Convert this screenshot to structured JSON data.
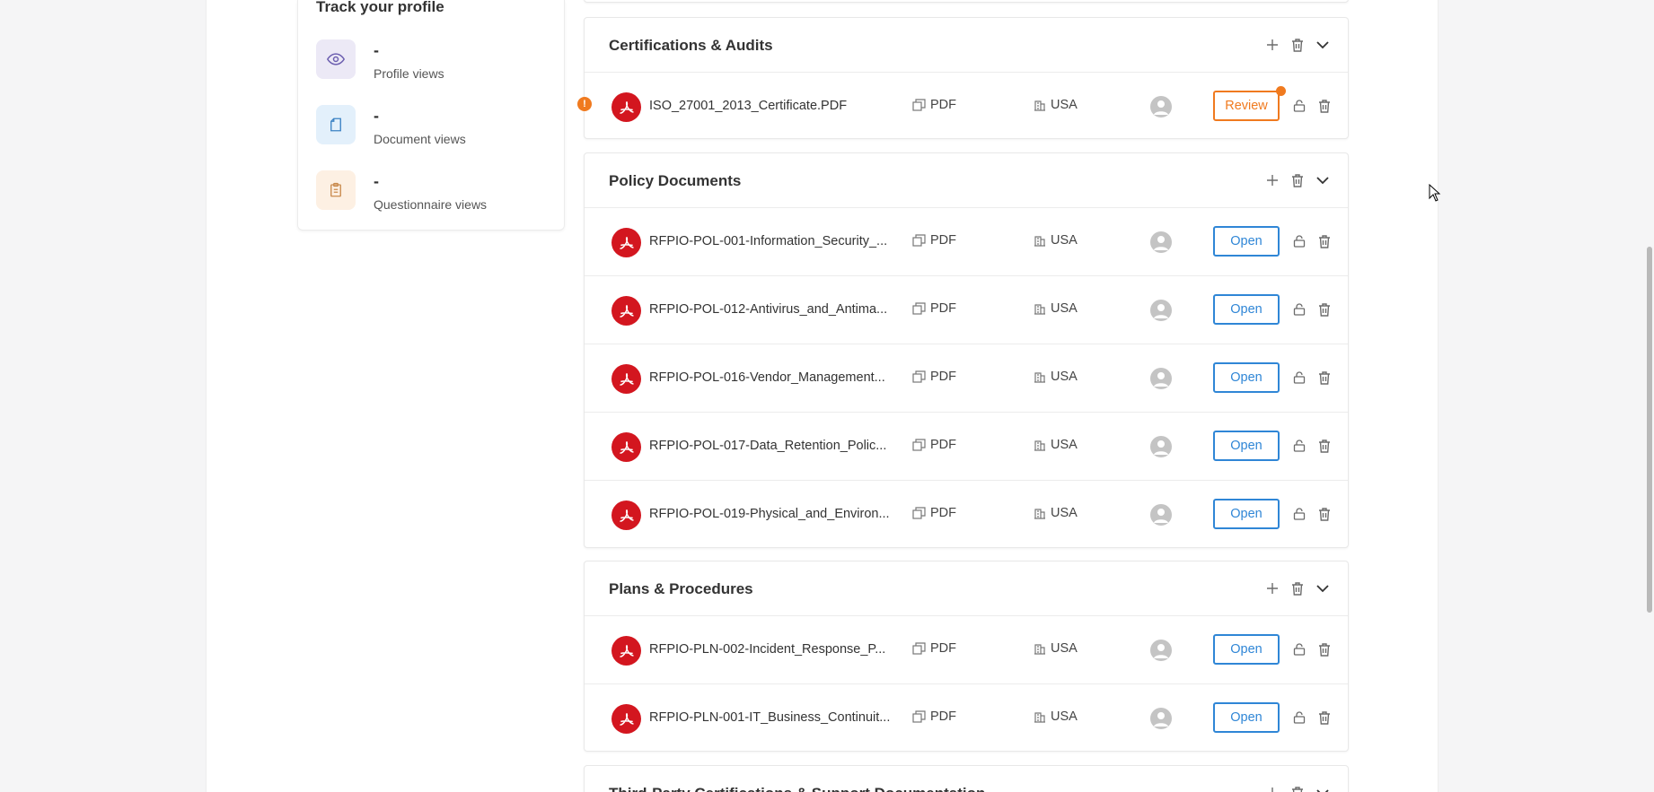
{
  "track": {
    "title": "Track your profile",
    "stats": [
      {
        "value": "-",
        "label": "Profile views",
        "icon": "eye-icon",
        "bg": "#ece9f6",
        "color": "#6d5fb0"
      },
      {
        "value": "-",
        "label": "Document views",
        "icon": "document-icon",
        "bg": "#e3f0fb",
        "color": "#3b82c4"
      },
      {
        "value": "-",
        "label": "Questionnaire views",
        "icon": "clipboard-icon",
        "bg": "#fdf0e3",
        "color": "#c98a4d"
      }
    ]
  },
  "sections": [
    {
      "title": "Certifications & Audits",
      "rows": [
        {
          "name": "ISO_27001_2013_Certificate.PDF",
          "type": "PDF",
          "region": "USA",
          "action": "Review",
          "warning": "!"
        }
      ]
    },
    {
      "title": "Policy Documents",
      "rows": [
        {
          "name": "RFPIO-POL-001-Information_Security_...",
          "type": "PDF",
          "region": "USA",
          "action": "Open"
        },
        {
          "name": "RFPIO-POL-012-Antivirus_and_Antima...",
          "type": "PDF",
          "region": "USA",
          "action": "Open"
        },
        {
          "name": "RFPIO-POL-016-Vendor_Management...",
          "type": "PDF",
          "region": "USA",
          "action": "Open"
        },
        {
          "name": "RFPIO-POL-017-Data_Retention_Polic...",
          "type": "PDF",
          "region": "USA",
          "action": "Open"
        },
        {
          "name": "RFPIO-POL-019-Physical_and_Environ...",
          "type": "PDF",
          "region": "USA",
          "action": "Open"
        }
      ]
    },
    {
      "title": "Plans & Procedures",
      "rows": [
        {
          "name": "RFPIO-PLN-002-Incident_Response_P...",
          "type": "PDF",
          "region": "USA",
          "action": "Open"
        },
        {
          "name": "RFPIO-PLN-001-IT_Business_Continuit...",
          "type": "PDF",
          "region": "USA",
          "action": "Open"
        }
      ]
    },
    {
      "title": "Third-Party Certifications & Support Documentation",
      "rows": []
    }
  ],
  "colors": {
    "pdf_red": "#d3161f",
    "open_blue": "#2f86d6",
    "review_orange": "#f07a1f"
  }
}
